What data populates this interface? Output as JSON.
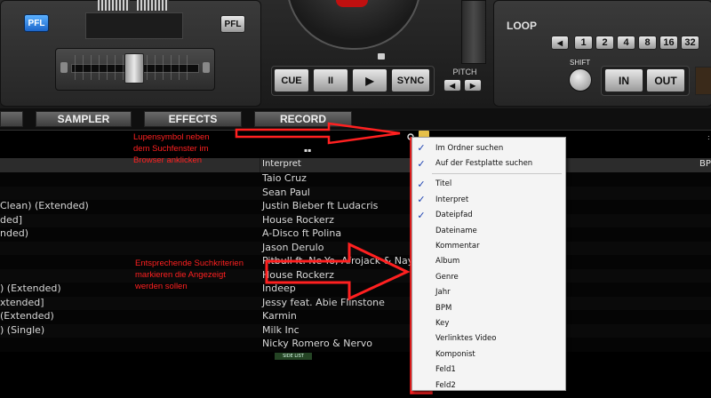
{
  "deck": {
    "pfl_left": "PFL",
    "pfl_right": "PFL",
    "cue": "CUE",
    "pause": "II",
    "play": "▶",
    "sync": "SYNC",
    "pitch": "PITCH",
    "loop": "LOOP",
    "loop_sizes": [
      "1",
      "2",
      "4",
      "8",
      "16",
      "32"
    ],
    "shift": "SHIFT",
    "in": "IN",
    "out": "OUT"
  },
  "tabs": [
    {
      "label": "SAMPLER"
    },
    {
      "label": "EFFECTS"
    },
    {
      "label": "RECORD"
    }
  ],
  "browser": {
    "column_header": "Interpret",
    "column_header_right": "BP",
    "side_list": "SIDE LIST",
    "rows": [
      {
        "left": "",
        "artist": "Taio Cruz"
      },
      {
        "left": "",
        "artist": "Sean Paul"
      },
      {
        "left": "Clean) (Extended)",
        "artist": "Justin Bieber ft Ludacris"
      },
      {
        "left": "ded]",
        "artist": "House Rockerz"
      },
      {
        "left": "nded)",
        "artist": "A-Disco ft Polina"
      },
      {
        "left": "",
        "artist": "Jason Derulo"
      },
      {
        "left": "",
        "artist": "Pitbull ft. Ne-Yo, Afrojack & Nay"
      },
      {
        "left": "",
        "artist": "House Rockerz"
      },
      {
        "left": ") (Extended)",
        "artist": "Indeep"
      },
      {
        "left": "xtended]",
        "artist": "Jessy feat. Abie Flinstone"
      },
      {
        "left": " (Extended)",
        "artist": "Karmin"
      },
      {
        "left": ") (Single)",
        "artist": "Milk Inc"
      },
      {
        "left": "",
        "artist": "Nicky Romero & Nervo"
      }
    ]
  },
  "annotations": {
    "note1_lines": [
      "Lupensymbol neben",
      "dem Suchfenster im",
      "Browser anklicken"
    ],
    "note2_lines": [
      "Entsprechende Suchkriterien",
      "markieren die Angezeigt",
      "werden sollen"
    ]
  },
  "menu": {
    "items": [
      {
        "label": "Im Ordner suchen",
        "checked": true
      },
      {
        "label": "Auf der Festplatte suchen",
        "checked": true
      },
      {
        "label": "Titel",
        "checked": true
      },
      {
        "label": "Interpret",
        "checked": true
      },
      {
        "label": "Dateipfad",
        "checked": true
      },
      {
        "label": "Dateiname",
        "checked": false
      },
      {
        "label": "Kommentar",
        "checked": false
      },
      {
        "label": "Album",
        "checked": false
      },
      {
        "label": "Genre",
        "checked": false
      },
      {
        "label": "Jahr",
        "checked": false
      },
      {
        "label": "BPM",
        "checked": false
      },
      {
        "label": "Key",
        "checked": false
      },
      {
        "label": "Verlinktes Video",
        "checked": false
      },
      {
        "label": "Komponist",
        "checked": false
      },
      {
        "label": "Feld1",
        "checked": false
      },
      {
        "label": "Feld2",
        "checked": false
      }
    ]
  },
  "colors": {
    "annotation_red": "#ff2020",
    "pfl_active": "#2f7fe0",
    "check_blue": "#1a3fb0"
  }
}
